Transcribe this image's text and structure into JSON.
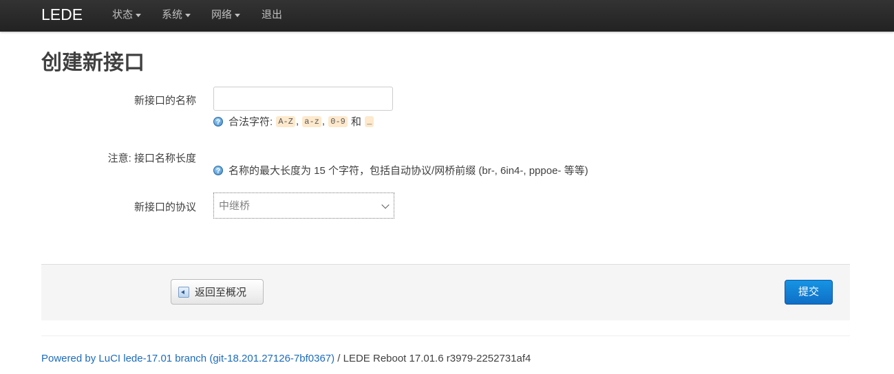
{
  "navbar": {
    "brand": "LEDE",
    "menu": [
      "状态",
      "系统",
      "网络",
      "退出"
    ]
  },
  "page": {
    "title": "创建新接口"
  },
  "form": {
    "name": {
      "label": "新接口的名称",
      "value": "",
      "hint_prefix": "合法字符:",
      "codes": [
        "A-Z",
        "a-z",
        "0-9"
      ],
      "hint_and": "和",
      "code_last": "_"
    },
    "note": {
      "label": "注意: 接口名称长度",
      "hint": "名称的最大长度为 15 个字符，包括自动协议/网桥前缀 (br-, 6in4-, pppoe- 等等)"
    },
    "protocol": {
      "label": "新接口的协议",
      "selected": "中继桥"
    }
  },
  "actions": {
    "back_label": "返回至概况",
    "submit_label": "提交"
  },
  "footer": {
    "link_text": "Powered by LuCI lede-17.01 branch (git-18.201.27126-7bf0367)",
    "rest_text": "/ LEDE Reboot 17.01.6 r3979-2252731af4"
  },
  "colors": {
    "navbar_bg": "#222222",
    "accent": "#0f6fc6",
    "link": "#1b6bbd"
  }
}
